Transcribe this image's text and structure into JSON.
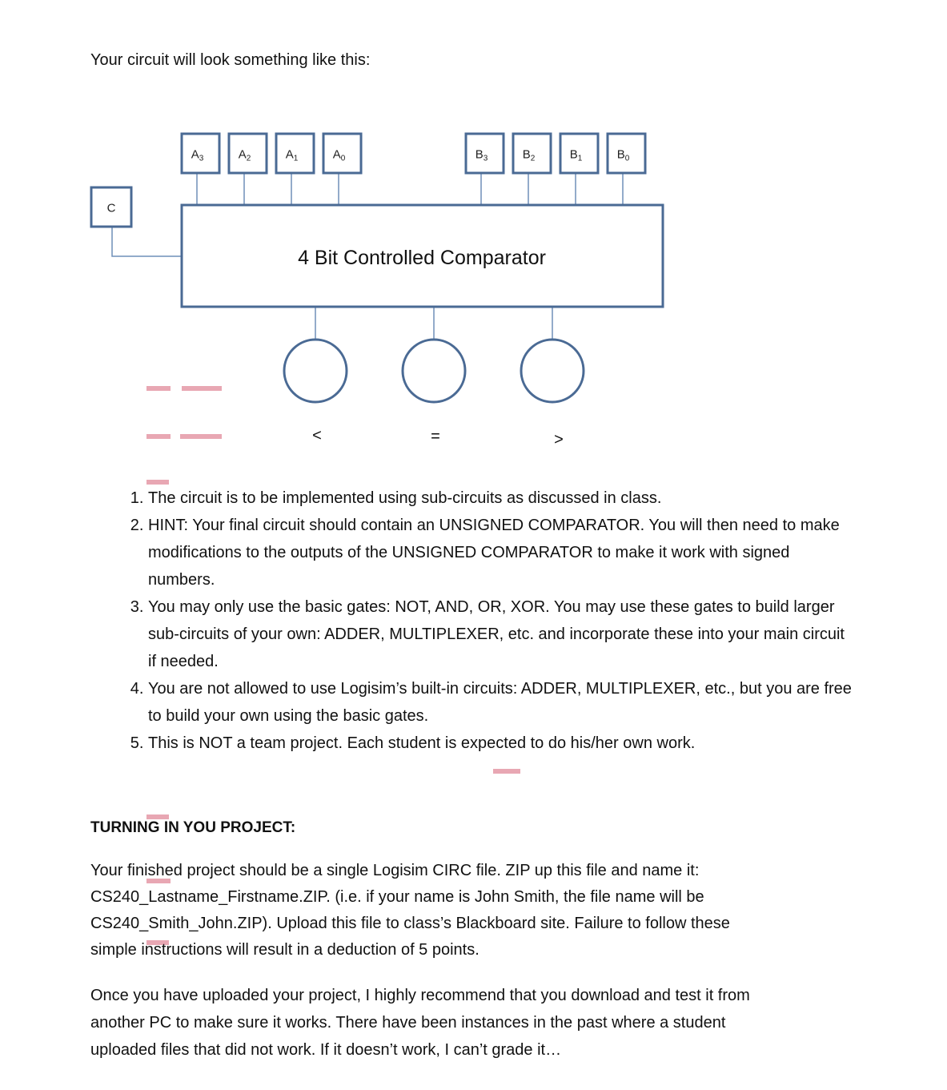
{
  "intro": "Your circuit will look something like this:",
  "diagram": {
    "control_input": "C",
    "a_inputs": [
      {
        "base": "A",
        "sub": "3"
      },
      {
        "base": "A",
        "sub": "2"
      },
      {
        "base": "A",
        "sub": "1"
      },
      {
        "base": "A",
        "sub": "0"
      }
    ],
    "b_inputs": [
      {
        "base": "B",
        "sub": "3"
      },
      {
        "base": "B",
        "sub": "2"
      },
      {
        "base": "B",
        "sub": "1"
      },
      {
        "base": "B",
        "sub": "0"
      }
    ],
    "block_title": "4 Bit Controlled Comparator",
    "outputs": [
      "<",
      "=",
      ">"
    ],
    "colors": {
      "stroke": "#4a6a94",
      "wire": "#6f8fb8"
    }
  },
  "rules": [
    "The circuit is to be implemented using sub-circuits as discussed in class.",
    "HINT:  Your final circuit should contain an UNSIGNED COMPARATOR.  You will then need to make modifications to the outputs of the UNSIGNED COMPARATOR to make it work with signed numbers.",
    "You may only use the basic gates:  NOT, AND, OR, XOR.  You may use these gates to build larger sub-circuits of your own:  ADDER, MULTIPLEXER, etc.  and incorporate these into your main circuit if needed.",
    "You are not allowed to use Logisim’s built-in circuits:  ADDER, MULTIPLEXER, etc., but you are free to build your own using the basic gates.",
    "This is NOT a team project.  Each student is expected to do his/her own work."
  ],
  "turnin": {
    "heading": "TURNING IN YOU PROJECT:",
    "lines": [
      "Your finished project should be a single Logisim CIRC file.  ZIP up this file and name it:",
      "CS240_Lastname_Firstname.ZIP. (i.e. if your name is John Smith, the file name will be",
      "CS240_Smith_John.ZIP).  Upload this file to class’s Blackboard site.  Failure to follow these",
      "simple instructions will result in a deduction of 5 points."
    ]
  },
  "closing": {
    "lines": [
      "Once you have uploaded your project, I highly recommend that you download and test it from",
      "another PC to make sure it works.  There have been instances in the past where a student",
      "uploaded files that did not work.  If it doesn’t work, I can’t grade it…"
    ]
  }
}
